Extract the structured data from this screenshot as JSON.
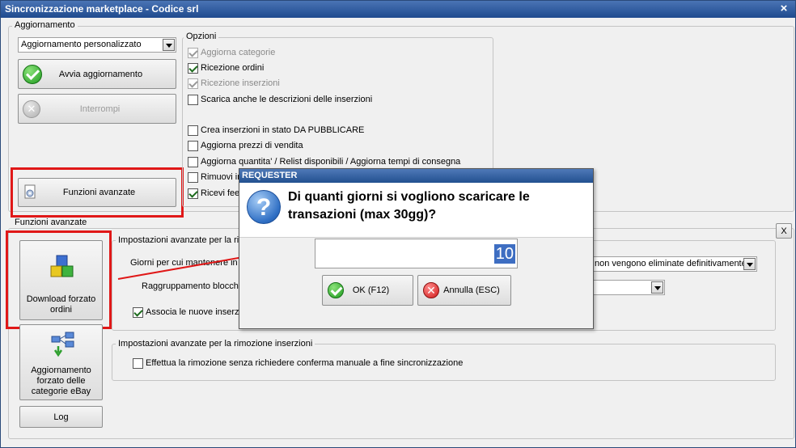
{
  "window": {
    "title": "Sincronizzazione marketplace - Codice srl",
    "close_glyph": "×"
  },
  "aggiornamento": {
    "group_label": "Aggiornamento",
    "mode_select": "Aggiornamento personalizzato",
    "start_button": "Avvia aggiornamento",
    "stop_button": "Interrompi",
    "advanced_button": "Funzioni avanzate"
  },
  "opzioni": {
    "group_label": "Opzioni",
    "items": [
      {
        "label": "Aggiorna categorie",
        "checked": true,
        "disabled": true
      },
      {
        "label": "Ricezione ordini",
        "checked": true,
        "disabled": false
      },
      {
        "label": "Ricezione inserzioni",
        "checked": true,
        "disabled": true
      },
      {
        "label": "Scarica anche le descrizioni delle inserzioni",
        "checked": false,
        "disabled": false
      },
      {
        "label": "Crea inserzioni in stato DA PUBBLICARE",
        "checked": false,
        "disabled": false
      },
      {
        "label": "Aggiorna prezzi di vendita",
        "checked": false,
        "disabled": false
      },
      {
        "label": "Aggiorna quantita' / Relist disponibili / Aggiorna tempi di consegna",
        "checked": false,
        "disabled": false
      },
      {
        "label": "Rimuovi in",
        "checked": false,
        "disabled": false
      },
      {
        "label": "Ricevi fee",
        "checked": true,
        "disabled": false
      }
    ]
  },
  "funzioni_avanzate": {
    "group_label": "Funzioni avanzate",
    "close_label": "X",
    "download_button": "Download forzato ordini",
    "categories_button": "Aggiornamento forzato delle categorie eBay",
    "log_button": "Log",
    "settings_group_label": "Impostazioni avanzate per la ric",
    "giorni_label": "Giorni per cui mantenere in l",
    "giorni_select": "non vengono eliminate definitivamente",
    "raggruppamento_label": "Raggruppamento blocchi",
    "raggruppamento_select": "",
    "associa_label": "Associa le nuove inserzi",
    "removal_group_label": "Impostazioni avanzate per la rimozione inserzioni",
    "removal_checkbox": "Effettua la rimozione senza richiedere conferma manuale a fine sincronizzazione"
  },
  "requester": {
    "title": "REQUESTER",
    "question": "Di quanti giorni si vogliono scaricare le transazioni (max 30gg)?",
    "value": "10",
    "ok_button": "OK (F12)",
    "cancel_button": "Annulla (ESC)"
  },
  "colors": {
    "highlight": "#e01818",
    "titlebar": "#1f4a8e",
    "selection": "#3e6ec2"
  }
}
